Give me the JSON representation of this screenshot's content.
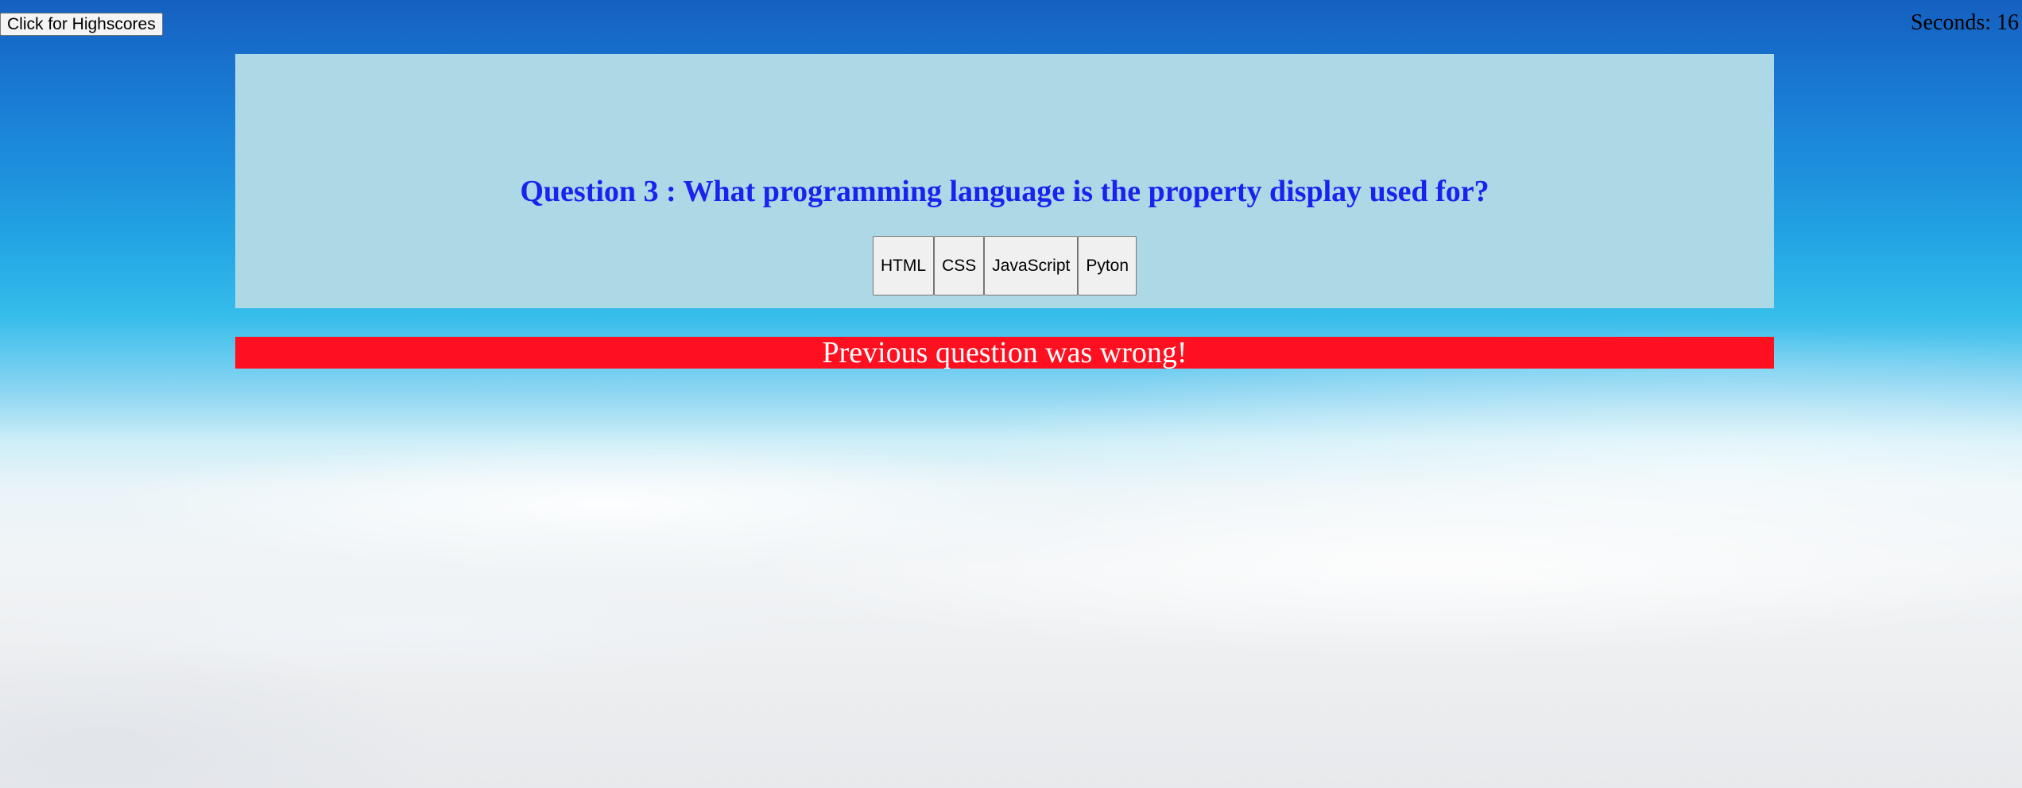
{
  "header": {
    "highscores_label": "Click for Highscores",
    "timer_text": "Seconds: 16"
  },
  "quiz": {
    "question": "Question 3 : What programming language is the property display used for?",
    "answers": [
      "HTML",
      "CSS",
      "JavaScript",
      "Pyton"
    ]
  },
  "feedback": {
    "message": "Previous question was wrong!"
  },
  "colors": {
    "card_background": "#add8e6",
    "question_text": "#1a22ee",
    "feedback_background": "#ff1020",
    "feedback_text": "#ffffff"
  }
}
